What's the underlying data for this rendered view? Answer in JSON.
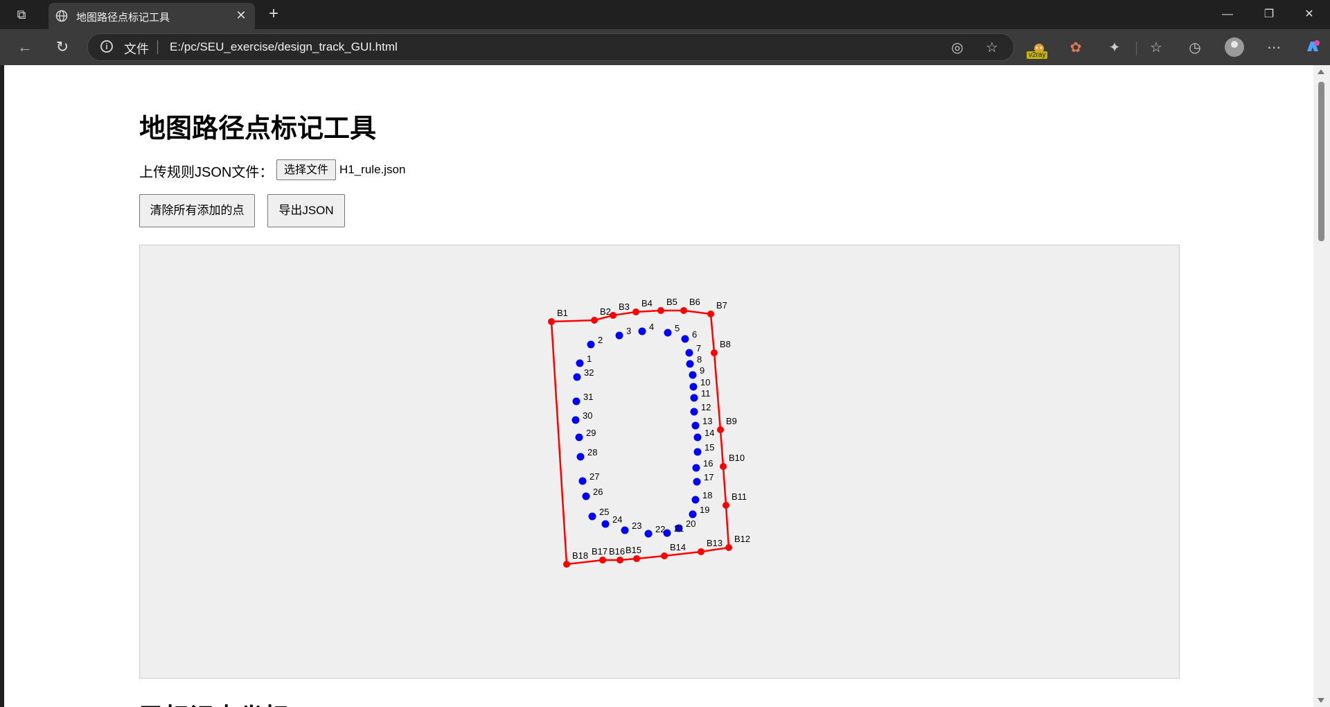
{
  "browser": {
    "tab_title": "地图路径点标记工具",
    "close_tab": "✕",
    "new_tab": "+",
    "url_protocol_label": "文件",
    "url": "E:/pc/SEU_exercise/design_track_GUI.html",
    "v2ray_badge": "v2ray",
    "window_controls": {
      "minimize": "—",
      "restore": "❐",
      "close": "✕"
    }
  },
  "page": {
    "title": "地图路径点标记工具",
    "upload_label": "上传规则JSON文件：",
    "file_button": "选择文件",
    "file_name": "H1_rule.json",
    "clear_button": "清除所有添加的点",
    "export_button": "导出JSON",
    "next_heading": "已标记点坐标"
  },
  "map": {
    "boundary_color": "#ff0000",
    "waypoint_color": "#0000ff",
    "boundary_points": [
      {
        "label": "B1"
      },
      {
        "label": "B2"
      },
      {
        "label": "B3"
      },
      {
        "label": "B4"
      },
      {
        "label": "B5"
      },
      {
        "label": "B6"
      },
      {
        "label": "B7"
      },
      {
        "label": "B8"
      },
      {
        "label": "B9"
      },
      {
        "label": "B10"
      },
      {
        "label": "B11"
      },
      {
        "label": "B12"
      },
      {
        "label": "B13"
      },
      {
        "label": "B14"
      },
      {
        "label": "B15"
      },
      {
        "label": "B16"
      },
      {
        "label": "B17"
      },
      {
        "label": "B18"
      }
    ],
    "waypoints": [
      {
        "label": "1"
      },
      {
        "label": "2"
      },
      {
        "label": "3"
      },
      {
        "label": "4"
      },
      {
        "label": "5"
      },
      {
        "label": "6"
      },
      {
        "label": "7"
      },
      {
        "label": "8"
      },
      {
        "label": "9"
      },
      {
        "label": "10"
      },
      {
        "label": "11"
      },
      {
        "label": "12"
      },
      {
        "label": "13"
      },
      {
        "label": "14"
      },
      {
        "label": "15"
      },
      {
        "label": "16"
      },
      {
        "label": "17"
      },
      {
        "label": "18"
      },
      {
        "label": "19"
      },
      {
        "label": "20"
      },
      {
        "label": "21"
      },
      {
        "label": "22"
      },
      {
        "label": "23"
      },
      {
        "label": "24"
      },
      {
        "label": "25"
      },
      {
        "label": "26"
      },
      {
        "label": "27"
      },
      {
        "label": "28"
      },
      {
        "label": "29"
      },
      {
        "label": "30"
      },
      {
        "label": "31"
      },
      {
        "label": "32"
      }
    ]
  }
}
